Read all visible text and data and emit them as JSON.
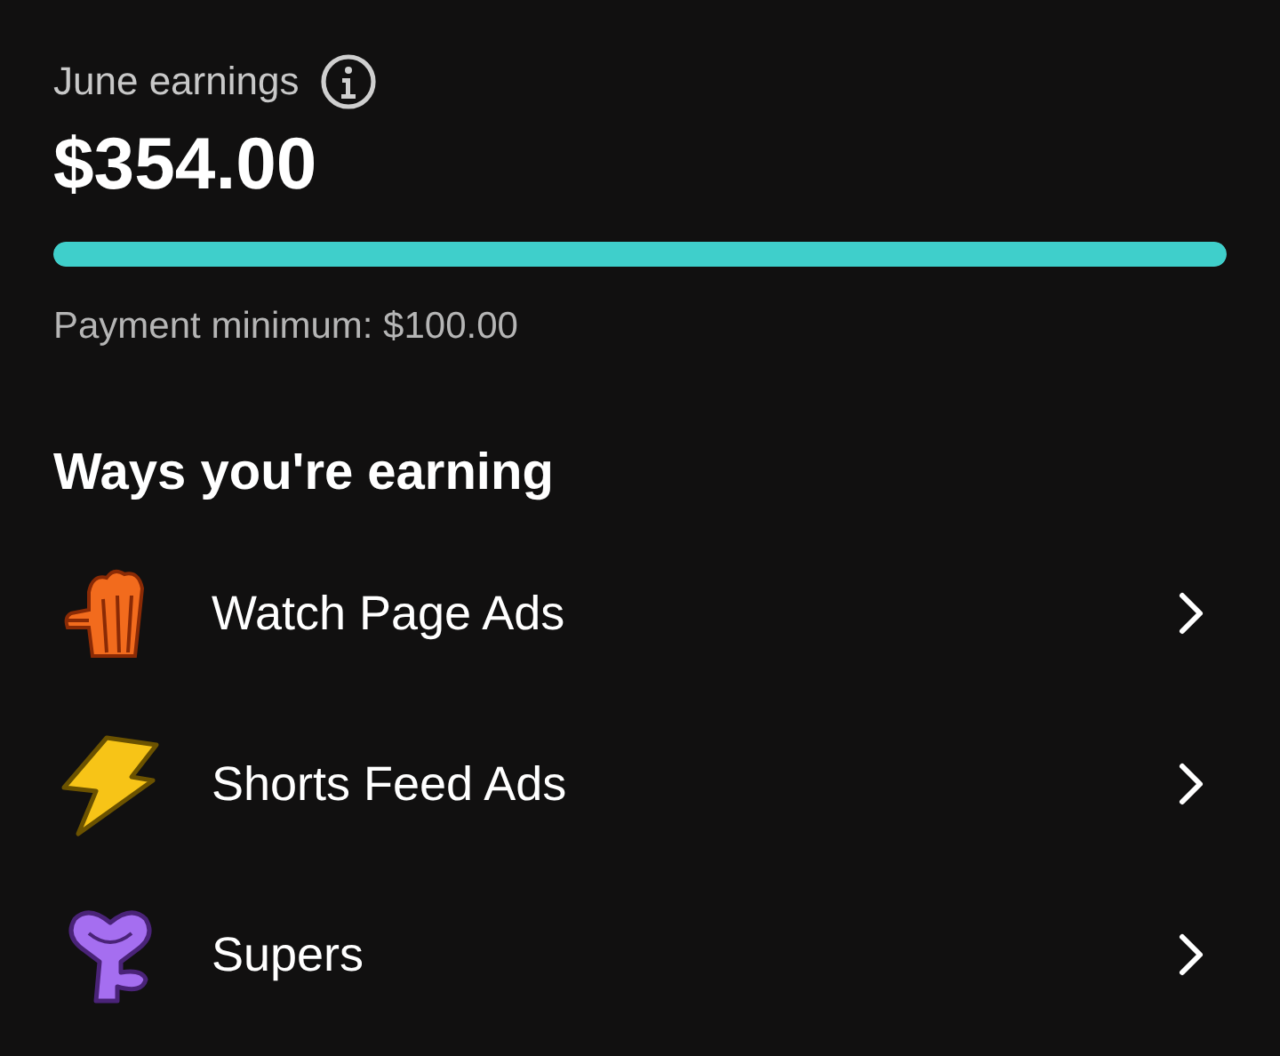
{
  "earnings": {
    "label": "June earnings",
    "amount": "$354.00",
    "level": 1,
    "minimum": "Payment minimum: $100.00"
  },
  "section": {
    "title": "Ways you're earning"
  },
  "items": [
    {
      "kind": "popcorn",
      "label": "Watch Page Ads"
    },
    {
      "kind": "bolt",
      "label": "Shorts Feed Ads"
    },
    {
      "kind": "heart",
      "label": "Supers"
    }
  ]
}
